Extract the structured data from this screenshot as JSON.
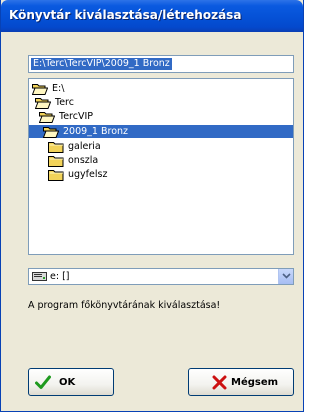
{
  "window": {
    "title": "Könyvtár kiválasztása/létrehozása"
  },
  "path_field": {
    "value": "E:\\Terc\\TercVIP\\2009_1 Bronz"
  },
  "tree": {
    "items": [
      {
        "label": "E:\\",
        "state": "open"
      },
      {
        "label": "Terc",
        "state": "open"
      },
      {
        "label": "TercVIP",
        "state": "open"
      },
      {
        "label": "2009_1 Bronz",
        "state": "open",
        "selected": true
      },
      {
        "label": "galeria",
        "state": "closed"
      },
      {
        "label": "onszla",
        "state": "closed"
      },
      {
        "label": "ugyfelsz",
        "state": "closed"
      }
    ]
  },
  "drive_select": {
    "value": "e: []"
  },
  "status": {
    "text": "A program főkönyvtárának kiválasztása!"
  },
  "buttons": {
    "ok": "OK",
    "cancel": "Mégsem"
  },
  "colors": {
    "title_bar": "#0551d6",
    "selection": "#316ac5",
    "dialog_bg": "#ece9d8",
    "folder": "#f2d35a"
  }
}
